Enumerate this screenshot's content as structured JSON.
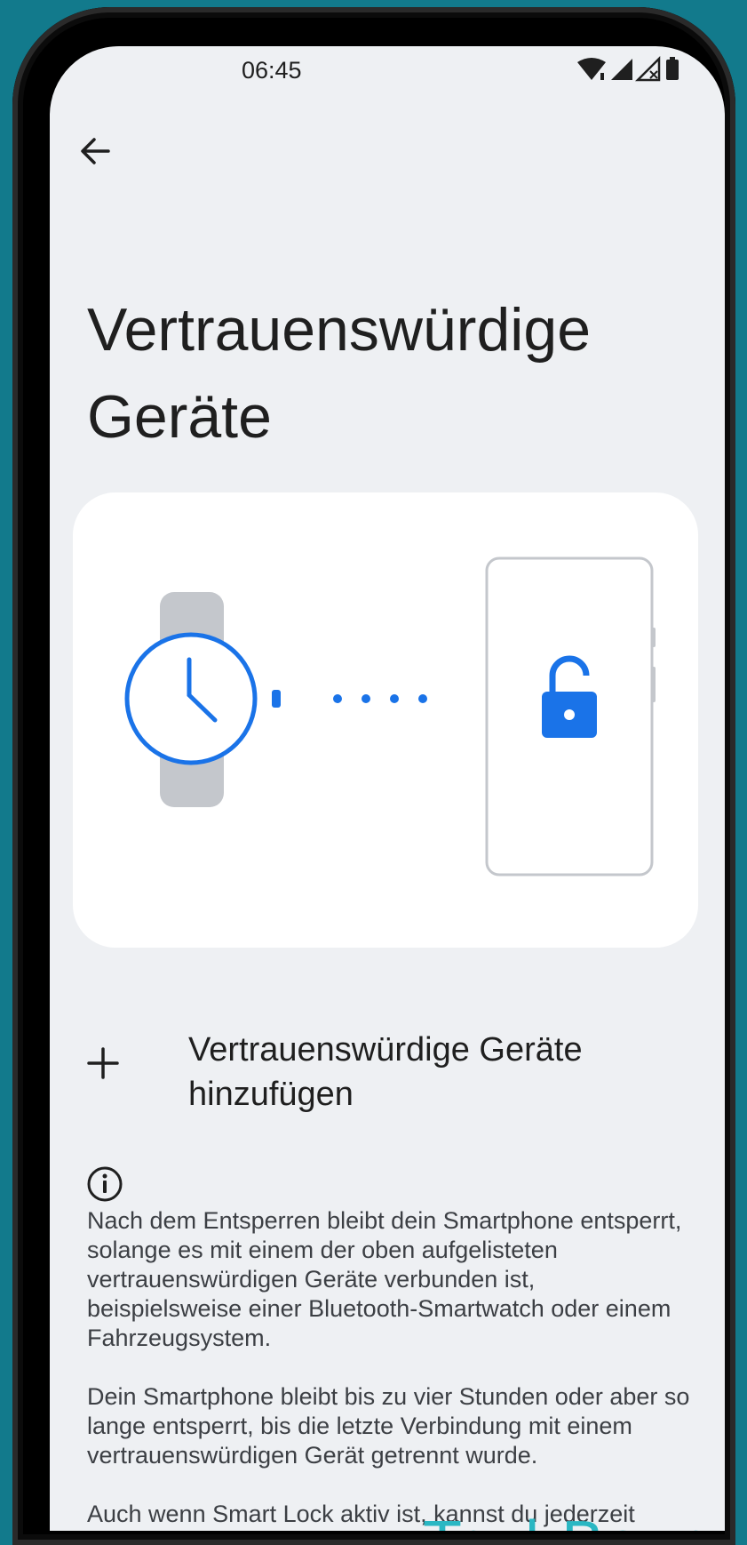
{
  "status_bar": {
    "time": "06:45",
    "icons": [
      "wifi-icon",
      "cell-signal-icon",
      "cell-signal-no-service-icon",
      "battery-icon"
    ]
  },
  "nav": {
    "back_icon": "arrow-left-icon"
  },
  "page": {
    "title": "Vertrauenswürdige Geräte"
  },
  "illustration": {
    "items": [
      "smartwatch-icon",
      "connection-dots",
      "phone-unlocked-icon"
    ],
    "accent_color": "#1a73e8",
    "strap_color": "#c4c7cc"
  },
  "add_device": {
    "icon": "plus-icon",
    "label": "Vertrauenswürdige Geräte hinzufügen"
  },
  "info": {
    "icon": "info-icon",
    "paragraphs": [
      "Nach dem Entsperren bleibt dein Smartphone entsperrt, solange es mit einem der oben aufgelisteten vertrauenswürdigen Geräte verbunden ist, beispielsweise einer Bluetooth-Smartwatch oder einem Fahrzeugsystem.",
      "Dein Smartphone bleibt bis zu vier Stunden oder aber so lange entsperrt, bis die letzte Verbindung mit einem vertrauenswürdigen Gerät getrennt wurde.",
      "Auch wenn Smart Lock aktiv ist, kannst du jederzeit"
    ]
  },
  "watermark": {
    "text": "TechBone",
    "color": "#2ab7c3"
  },
  "colors": {
    "background": "#127a8c",
    "screen": "#eef0f3",
    "card": "#ffffff"
  }
}
